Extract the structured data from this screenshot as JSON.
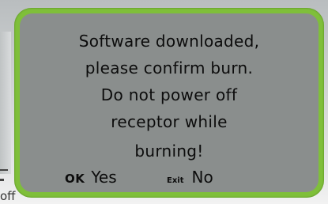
{
  "dialog": {
    "lines": [
      "Software downloaded,",
      "please confirm burn.",
      "Do not power off",
      "receptor while",
      "burning!"
    ],
    "confirm_key": "OK",
    "confirm_label": "Yes",
    "cancel_key": "Exit",
    "cancel_label": "No"
  },
  "background": {
    "partial_text": "off"
  },
  "colors": {
    "dialog_border": "#7fbf3a",
    "dialog_fill": "#8a8e8d",
    "text": "#0c0c0c"
  }
}
